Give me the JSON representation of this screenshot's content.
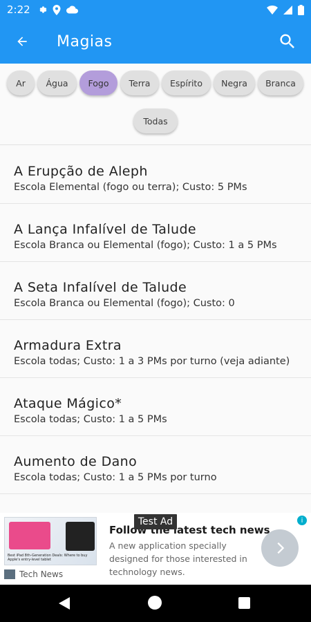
{
  "status_bar": {
    "time": "2:22",
    "icons": [
      "gear-icon",
      "location-icon",
      "cloud-icon",
      "wifi-icon",
      "signal-icon",
      "battery-icon"
    ]
  },
  "app_bar": {
    "title": "Magias",
    "back_icon": "arrow-left-icon",
    "search_icon": "search-icon",
    "color": "#2196f3"
  },
  "filters": {
    "active_color": "#b39ddb",
    "chips": [
      {
        "label": "Ar"
      },
      {
        "label": "Água"
      },
      {
        "label": "Fogo",
        "active": true
      },
      {
        "label": "Terra"
      },
      {
        "label": "Espírito"
      },
      {
        "label": "Negra"
      },
      {
        "label": "Branca"
      },
      {
        "label": "Todas"
      }
    ]
  },
  "spells": [
    {
      "name": "A Erupção de Aleph",
      "detail": "Escola Elemental (fogo ou terra); Custo: 5 PMs"
    },
    {
      "name": "A Lança Infalível de Talude",
      "detail": "Escola Branca ou Elemental (fogo); Custo: 1 a 5 PMs"
    },
    {
      "name": "A Seta Infalível de Talude",
      "detail": "Escola Branca ou Elemental (fogo); Custo: 0"
    },
    {
      "name": "Armadura Extra",
      "detail": "Escola todas; Custo: 1 a 3 PMs por turno (veja adiante)"
    },
    {
      "name": "Ataque Mágico*",
      "detail": "Escola todas; Custo: 1 a 5 PMs"
    },
    {
      "name": "Aumento de Dano",
      "detail": "Escola todas; Custo: 1 a 5 PMs por turno"
    }
  ],
  "ad": {
    "badge": "Test Ad",
    "title": "Follow the latest tech news",
    "body": "A new application specially designed for those interested in technology news.",
    "brand": "Tech News",
    "image_caption": "Best iPad 8th-Generation Deals: Where to buy Apple's entry-level tablet",
    "cta_icon": "chevron-right-icon",
    "info_icon": "info-icon"
  },
  "nav_bar": {
    "icons": [
      "back-triangle-icon",
      "home-circle-icon",
      "recents-square-icon"
    ]
  }
}
